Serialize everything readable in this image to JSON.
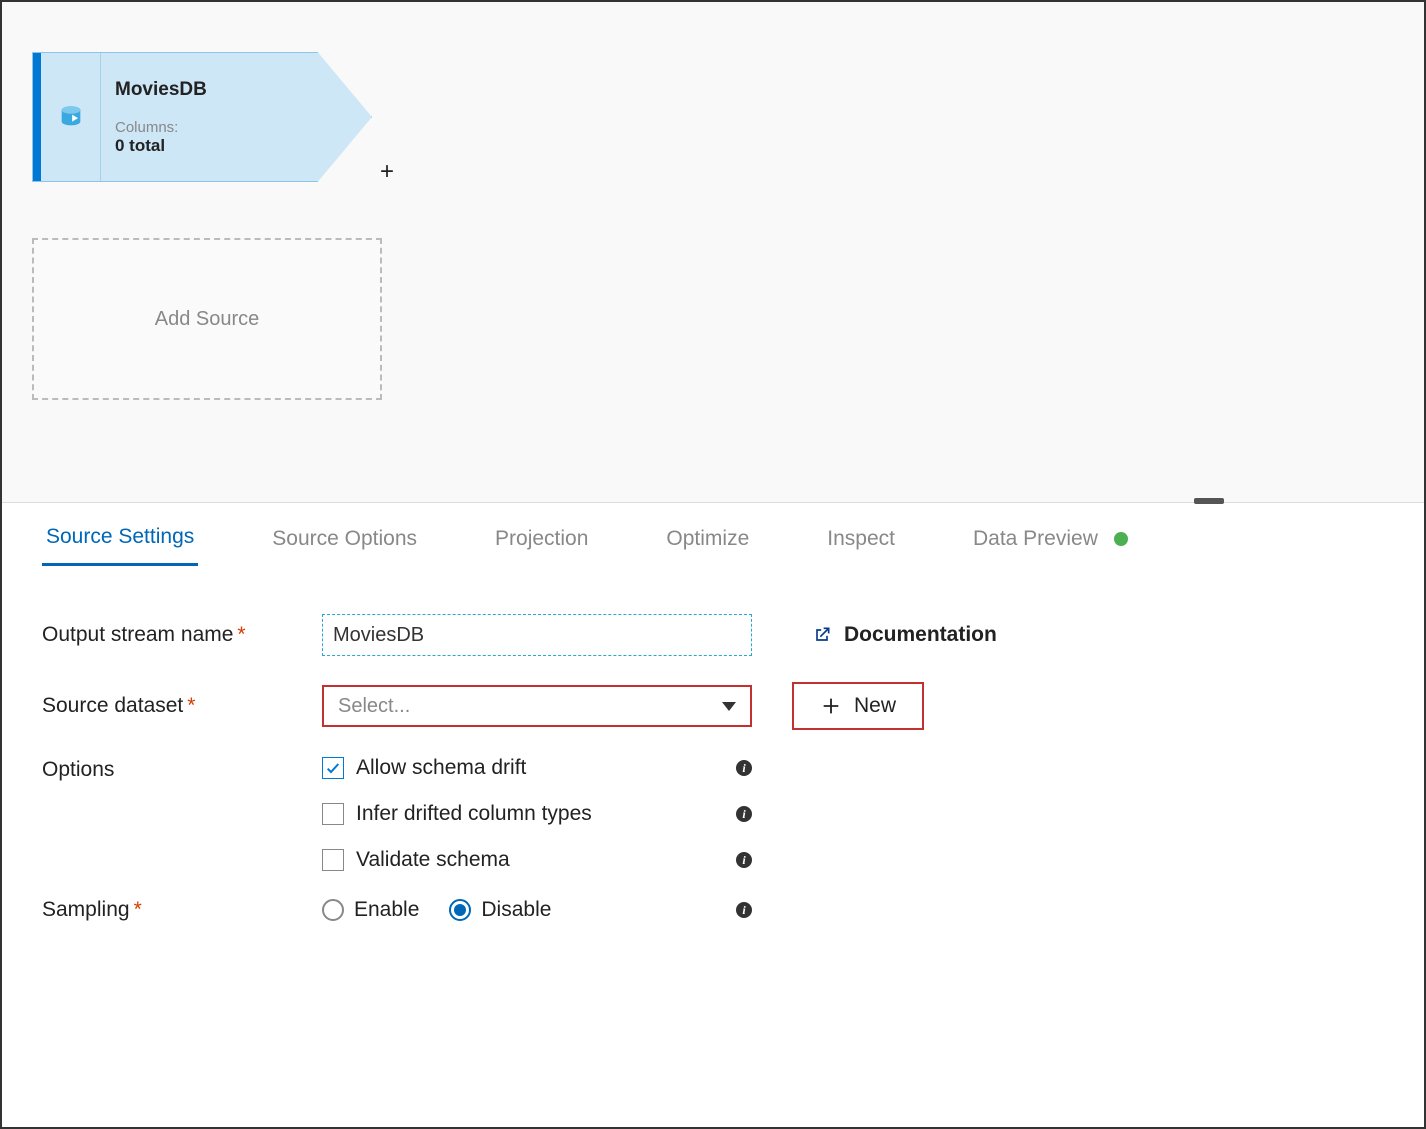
{
  "canvas": {
    "node": {
      "title": "MoviesDB",
      "columns_label": "Columns:",
      "columns_count": "0 total"
    },
    "add_source_label": "Add Source"
  },
  "tabs": [
    {
      "label": "Source Settings",
      "active": true
    },
    {
      "label": "Source Options",
      "active": false
    },
    {
      "label": "Projection",
      "active": false
    },
    {
      "label": "Optimize",
      "active": false
    },
    {
      "label": "Inspect",
      "active": false
    },
    {
      "label": "Data Preview",
      "active": false,
      "status": "ok"
    }
  ],
  "form": {
    "output_stream_label": "Output stream name",
    "output_stream_value": "MoviesDB",
    "source_dataset_label": "Source dataset",
    "source_dataset_placeholder": "Select...",
    "options_label": "Options",
    "options": {
      "allow_schema_drift": {
        "label": "Allow schema drift",
        "checked": true
      },
      "infer_drifted": {
        "label": "Infer drifted column types",
        "checked": false
      },
      "validate_schema": {
        "label": "Validate schema",
        "checked": false
      }
    },
    "sampling_label": "Sampling",
    "sampling": {
      "enable_label": "Enable",
      "disable_label": "Disable",
      "value": "disable"
    },
    "documentation_label": "Documentation",
    "new_button_label": "New"
  }
}
